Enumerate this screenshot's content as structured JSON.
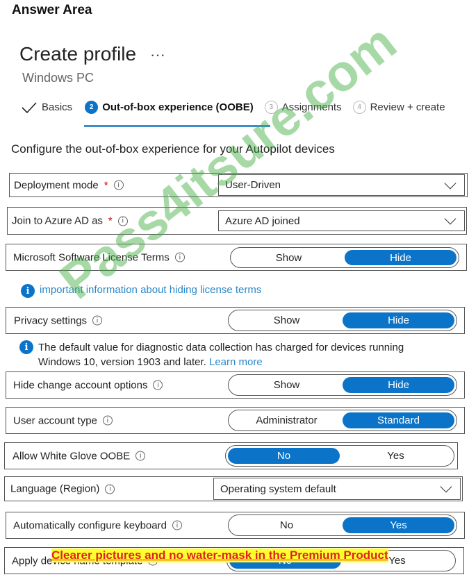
{
  "answer_area": "Answer Area",
  "header": {
    "title": "Create profile",
    "more": "···",
    "subtitle": "Windows PC"
  },
  "steps": [
    {
      "label": "Basics",
      "state": "done"
    },
    {
      "num": "2",
      "label": "Out-of-box experience (OOBE)",
      "state": "active"
    },
    {
      "num": "3",
      "label": "Assignments"
    },
    {
      "num": "4",
      "label": "Review + create"
    }
  ],
  "heading": "Configure the out-of-box experience for your Autopilot devices",
  "fields": {
    "deployment_mode": {
      "label": "Deployment mode",
      "value": "User-Driven"
    },
    "join_azure": {
      "label": "Join to Azure AD as",
      "value": "Azure AD joined"
    },
    "license_terms": {
      "label": "Microsoft Software License Terms",
      "options": [
        "Show",
        "Hide"
      ],
      "selected": "Hide"
    },
    "license_info": "important information about hiding license terms",
    "privacy": {
      "label": "Privacy settings",
      "options": [
        "Show",
        "Hide"
      ],
      "selected": "Hide"
    },
    "privacy_info": {
      "line1": "The default value for diagnostic data collection has charged for devices running",
      "line2": "Windows 10, version 1903 and later.",
      "link": "Learn more"
    },
    "hide_change_account": {
      "label": "Hide change account options",
      "options": [
        "Show",
        "Hide"
      ],
      "selected": "Hide"
    },
    "user_account_type": {
      "label": "User account type",
      "options": [
        "Administrator",
        "Standard"
      ],
      "selected": "Standard"
    },
    "white_glove": {
      "label": "Allow White Glove OOBE",
      "options": [
        "No",
        "Yes"
      ],
      "selected": "No"
    },
    "language": {
      "label": "Language (Region)",
      "value": "Operating system default"
    },
    "keyboard": {
      "label": "Automatically configure keyboard",
      "options": [
        "No",
        "Yes"
      ],
      "selected": "Yes"
    },
    "device_name": {
      "label": "Apply device name template",
      "options": [
        "No",
        "Yes"
      ],
      "selected": "No"
    }
  },
  "required_mark": "*",
  "info_glyph": "i",
  "watermark": "Pass4itsure.com",
  "banner": "Clearer pictures and no water-mask in the Premium Product",
  "colors": {
    "accent": "#0b74c9"
  }
}
